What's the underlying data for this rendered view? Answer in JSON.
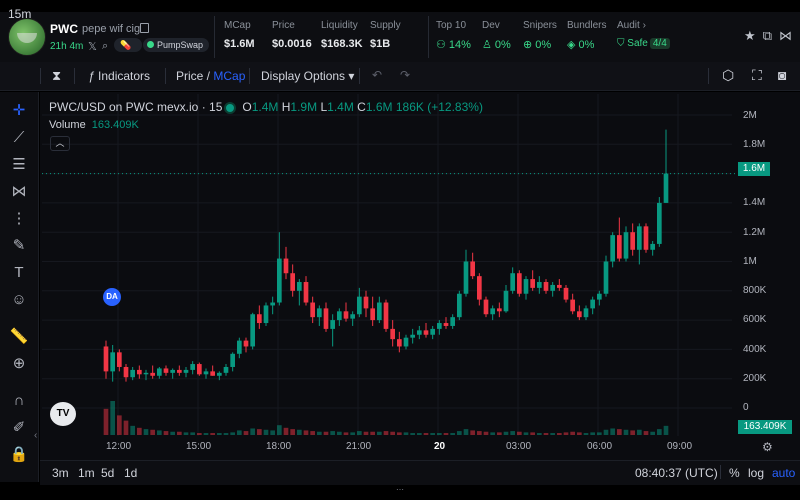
{
  "token": {
    "symbol": "PWC",
    "name": "pepe wif cig",
    "age": "21h 4m",
    "dex": "PumpSwap"
  },
  "stats": [
    {
      "label": "MCap",
      "value": "$1.6M"
    },
    {
      "label": "Price",
      "value": "$0.0016"
    },
    {
      "label": "Liquidity",
      "value": "$168.3K"
    },
    {
      "label": "Supply",
      "value": "$1B"
    }
  ],
  "audit_stats": [
    {
      "label": "Top 10",
      "value": "14%"
    },
    {
      "label": "Dev",
      "value": "0%"
    },
    {
      "label": "Snipers",
      "value": "0%"
    },
    {
      "label": "Bundlers",
      "value": "0%"
    },
    {
      "label": "Audit",
      "value": "Safe",
      "badge": "4/4"
    }
  ],
  "toolbar": {
    "interval": "15m",
    "indicators": "Indicators",
    "price_label": "Price /",
    "mcap_label": "MCap",
    "display_options": "Display Options"
  },
  "legend": {
    "title": "PWC/USD on PWC mevx.io · 15",
    "o_label": "O",
    "o": "1.4M",
    "h_label": "H",
    "h": "1.9M",
    "l_label": "L",
    "l": "1.4M",
    "c_label": "C",
    "c": "1.6M",
    "change": "186K (+12.83%)",
    "volume_label": "Volume",
    "volume": "163.409K"
  },
  "axis": {
    "y_ticks": [
      "2M",
      "1.8M",
      "1.6M",
      "1.4M",
      "1.2M",
      "1M",
      "800K",
      "600K",
      "400K",
      "200K",
      "0"
    ],
    "x_ticks": [
      "12:00",
      "15:00",
      "18:00",
      "21:00",
      "20",
      "03:00",
      "06:00",
      "09:00"
    ],
    "price_tag": "1.6M",
    "volume_tag": "163.409K"
  },
  "markers": {
    "da_badge": "DA",
    "tv_logo": "TV"
  },
  "bottom": {
    "ranges": [
      "3m",
      "1m",
      "5d",
      "1d"
    ],
    "time": "08:40:37 (UTC)",
    "percent": "%",
    "log": "log",
    "auto": "auto"
  },
  "colors": {
    "up": "#089981",
    "down": "#f23645",
    "accent": "#2962ff"
  },
  "chart_data": {
    "type": "candlestick",
    "title": "PWC/USD on PWC mevx.io · 15",
    "y_unit": "market cap (USD)",
    "ylim": [
      0,
      2000000
    ],
    "x_ticks": [
      "12:00",
      "15:00",
      "18:00",
      "21:00",
      "20",
      "03:00",
      "06:00",
      "09:00"
    ],
    "last": {
      "open": 1400000,
      "high": 1900000,
      "low": 1400000,
      "close": 1600000,
      "change": "186K (+12.83%)"
    },
    "volume_last": 163409,
    "candles": [
      [
        420000,
        460000,
        200000,
        250000
      ],
      [
        250000,
        430000,
        180000,
        380000
      ],
      [
        380000,
        400000,
        250000,
        280000
      ],
      [
        280000,
        300000,
        180000,
        210000
      ],
      [
        210000,
        280000,
        190000,
        260000
      ],
      [
        260000,
        290000,
        200000,
        230000
      ],
      [
        230000,
        260000,
        190000,
        240000
      ],
      [
        240000,
        290000,
        200000,
        220000
      ],
      [
        220000,
        280000,
        200000,
        270000
      ],
      [
        270000,
        290000,
        220000,
        240000
      ],
      [
        240000,
        270000,
        200000,
        260000
      ],
      [
        260000,
        290000,
        220000,
        240000
      ],
      [
        240000,
        280000,
        210000,
        260000
      ],
      [
        260000,
        320000,
        230000,
        300000
      ],
      [
        300000,
        310000,
        220000,
        230000
      ],
      [
        230000,
        270000,
        200000,
        250000
      ],
      [
        250000,
        290000,
        220000,
        220000
      ],
      [
        220000,
        250000,
        190000,
        240000
      ],
      [
        240000,
        300000,
        220000,
        280000
      ],
      [
        280000,
        380000,
        250000,
        370000
      ],
      [
        370000,
        480000,
        340000,
        460000
      ],
      [
        460000,
        480000,
        380000,
        420000
      ],
      [
        420000,
        650000,
        400000,
        640000
      ],
      [
        640000,
        700000,
        540000,
        580000
      ],
      [
        580000,
        720000,
        560000,
        700000
      ],
      [
        700000,
        760000,
        640000,
        720000
      ],
      [
        720000,
        1200000,
        700000,
        1020000
      ],
      [
        1020000,
        1100000,
        880000,
        920000
      ],
      [
        920000,
        980000,
        760000,
        800000
      ],
      [
        800000,
        880000,
        700000,
        860000
      ],
      [
        860000,
        900000,
        700000,
        720000
      ],
      [
        720000,
        760000,
        580000,
        620000
      ],
      [
        620000,
        700000,
        560000,
        680000
      ],
      [
        680000,
        720000,
        520000,
        540000
      ],
      [
        540000,
        640000,
        420000,
        600000
      ],
      [
        600000,
        680000,
        560000,
        660000
      ],
      [
        660000,
        720000,
        590000,
        610000
      ],
      [
        610000,
        660000,
        560000,
        640000
      ],
      [
        640000,
        820000,
        620000,
        760000
      ],
      [
        760000,
        800000,
        620000,
        680000
      ],
      [
        680000,
        760000,
        560000,
        600000
      ],
      [
        600000,
        760000,
        580000,
        720000
      ],
      [
        720000,
        740000,
        520000,
        540000
      ],
      [
        540000,
        600000,
        420000,
        470000
      ],
      [
        470000,
        520000,
        380000,
        420000
      ],
      [
        420000,
        500000,
        400000,
        480000
      ],
      [
        480000,
        540000,
        440000,
        500000
      ],
      [
        500000,
        560000,
        470000,
        530000
      ],
      [
        530000,
        580000,
        480000,
        500000
      ],
      [
        500000,
        560000,
        470000,
        540000
      ],
      [
        540000,
        600000,
        500000,
        580000
      ],
      [
        580000,
        620000,
        540000,
        560000
      ],
      [
        560000,
        640000,
        540000,
        620000
      ],
      [
        620000,
        800000,
        600000,
        780000
      ],
      [
        780000,
        1080000,
        760000,
        1000000
      ],
      [
        1000000,
        1060000,
        880000,
        900000
      ],
      [
        900000,
        920000,
        700000,
        740000
      ],
      [
        740000,
        760000,
        620000,
        640000
      ],
      [
        640000,
        700000,
        600000,
        680000
      ],
      [
        680000,
        720000,
        620000,
        660000
      ],
      [
        660000,
        840000,
        650000,
        800000
      ],
      [
        800000,
        960000,
        780000,
        920000
      ],
      [
        920000,
        940000,
        760000,
        780000
      ],
      [
        780000,
        900000,
        740000,
        880000
      ],
      [
        880000,
        940000,
        800000,
        820000
      ],
      [
        820000,
        900000,
        780000,
        860000
      ],
      [
        860000,
        880000,
        780000,
        800000
      ],
      [
        800000,
        860000,
        760000,
        840000
      ],
      [
        840000,
        880000,
        800000,
        820000
      ],
      [
        820000,
        840000,
        720000,
        740000
      ],
      [
        740000,
        780000,
        640000,
        660000
      ],
      [
        660000,
        700000,
        600000,
        620000
      ],
      [
        620000,
        700000,
        600000,
        680000
      ],
      [
        680000,
        760000,
        640000,
        740000
      ],
      [
        740000,
        800000,
        700000,
        780000
      ],
      [
        780000,
        1040000,
        760000,
        1000000
      ],
      [
        1000000,
        1200000,
        960000,
        1180000
      ],
      [
        1180000,
        1300000,
        1000000,
        1020000
      ],
      [
        1020000,
        1240000,
        1000000,
        1200000
      ],
      [
        1200000,
        1260000,
        1040000,
        1080000
      ],
      [
        1080000,
        1260000,
        980000,
        1240000
      ],
      [
        1240000,
        1260000,
        1060000,
        1080000
      ],
      [
        1080000,
        1140000,
        1040000,
        1120000
      ],
      [
        1120000,
        1440000,
        1100000,
        1400000
      ],
      [
        1400000,
        1900000,
        1400000,
        1600000
      ]
    ],
    "volume": [
      40000,
      52000,
      30000,
      22000,
      14000,
      11000,
      9000,
      8000,
      7000,
      6000,
      5000,
      5000,
      4000,
      4000,
      3000,
      3000,
      3000,
      3000,
      3000,
      4000,
      7000,
      6000,
      10000,
      9000,
      8000,
      7000,
      15000,
      11000,
      9000,
      8000,
      7000,
      6000,
      5000,
      5000,
      6000,
      5000,
      4000,
      4000,
      6000,
      5000,
      5000,
      5000,
      6000,
      5000,
      4000,
      4000,
      3000,
      3000,
      3000,
      3000,
      3000,
      3000,
      3000,
      6000,
      9000,
      7000,
      6000,
      5000,
      4000,
      4000,
      5000,
      6000,
      5000,
      4000,
      4000,
      3000,
      3000,
      3000,
      3000,
      4000,
      5000,
      4000,
      3000,
      4000,
      4000,
      8000,
      10000,
      9000,
      8000,
      7000,
      8000,
      6000,
      5000,
      9000,
      14000
    ]
  }
}
